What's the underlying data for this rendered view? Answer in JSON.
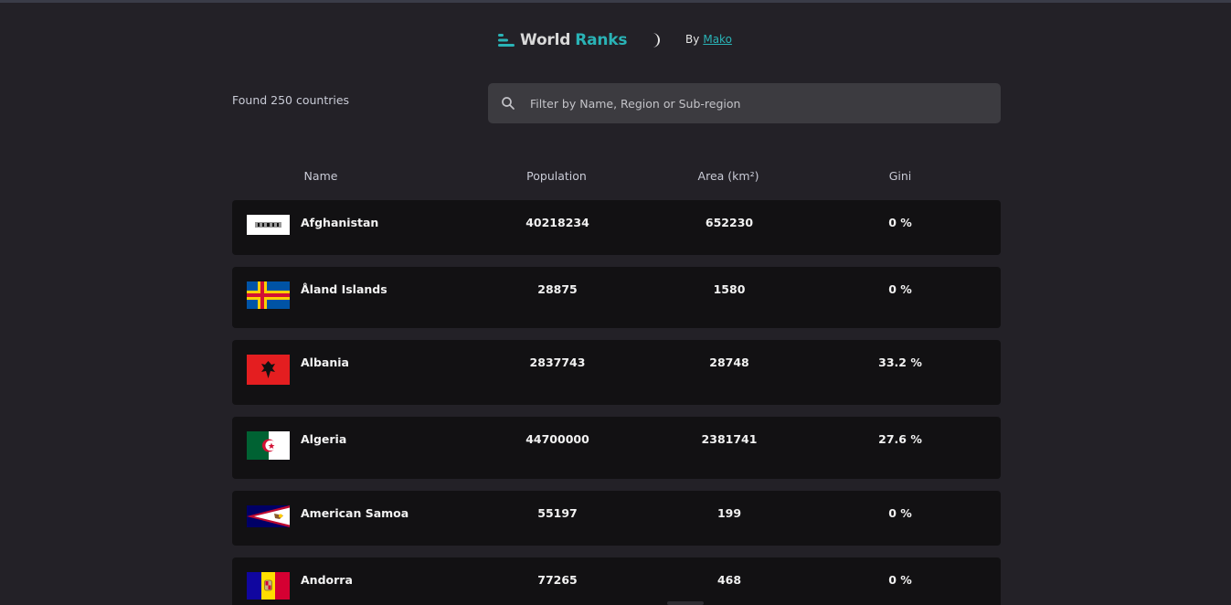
{
  "header": {
    "brand_word1": "World",
    "brand_word2": "Ranks",
    "by_label": "By",
    "author": "Mako"
  },
  "colors": {
    "background": "#232127",
    "accent": "#2ab3b6",
    "row_bg": "#121113",
    "search_bg": "#3c3b40"
  },
  "icons": {
    "logo": "ranks-bars-icon",
    "theme": "moon-icon",
    "search": "search-icon"
  },
  "summary": {
    "found_text": "Found 250 countries"
  },
  "search": {
    "placeholder": "Filter by Name, Region or Sub-region",
    "value": ""
  },
  "table": {
    "columns": [
      "Name",
      "Population",
      "Area (km²)",
      "Gini"
    ],
    "rows": [
      {
        "flag": "afghanistan-flag",
        "name": "Afghanistan",
        "population": "40218234",
        "area": "652230",
        "gini": "0 %"
      },
      {
        "flag": "aland-islands-flag",
        "name": "Åland Islands",
        "population": "28875",
        "area": "1580",
        "gini": "0 %"
      },
      {
        "flag": "albania-flag",
        "name": "Albania",
        "population": "2837743",
        "area": "28748",
        "gini": "33.2 %"
      },
      {
        "flag": "algeria-flag",
        "name": "Algeria",
        "population": "44700000",
        "area": "2381741",
        "gini": "27.6 %"
      },
      {
        "flag": "american-samoa-flag",
        "name": "American Samoa",
        "population": "55197",
        "area": "199",
        "gini": "0 %"
      },
      {
        "flag": "andorra-flag",
        "name": "Andorra",
        "population": "77265",
        "area": "468",
        "gini": "0 %"
      }
    ]
  }
}
